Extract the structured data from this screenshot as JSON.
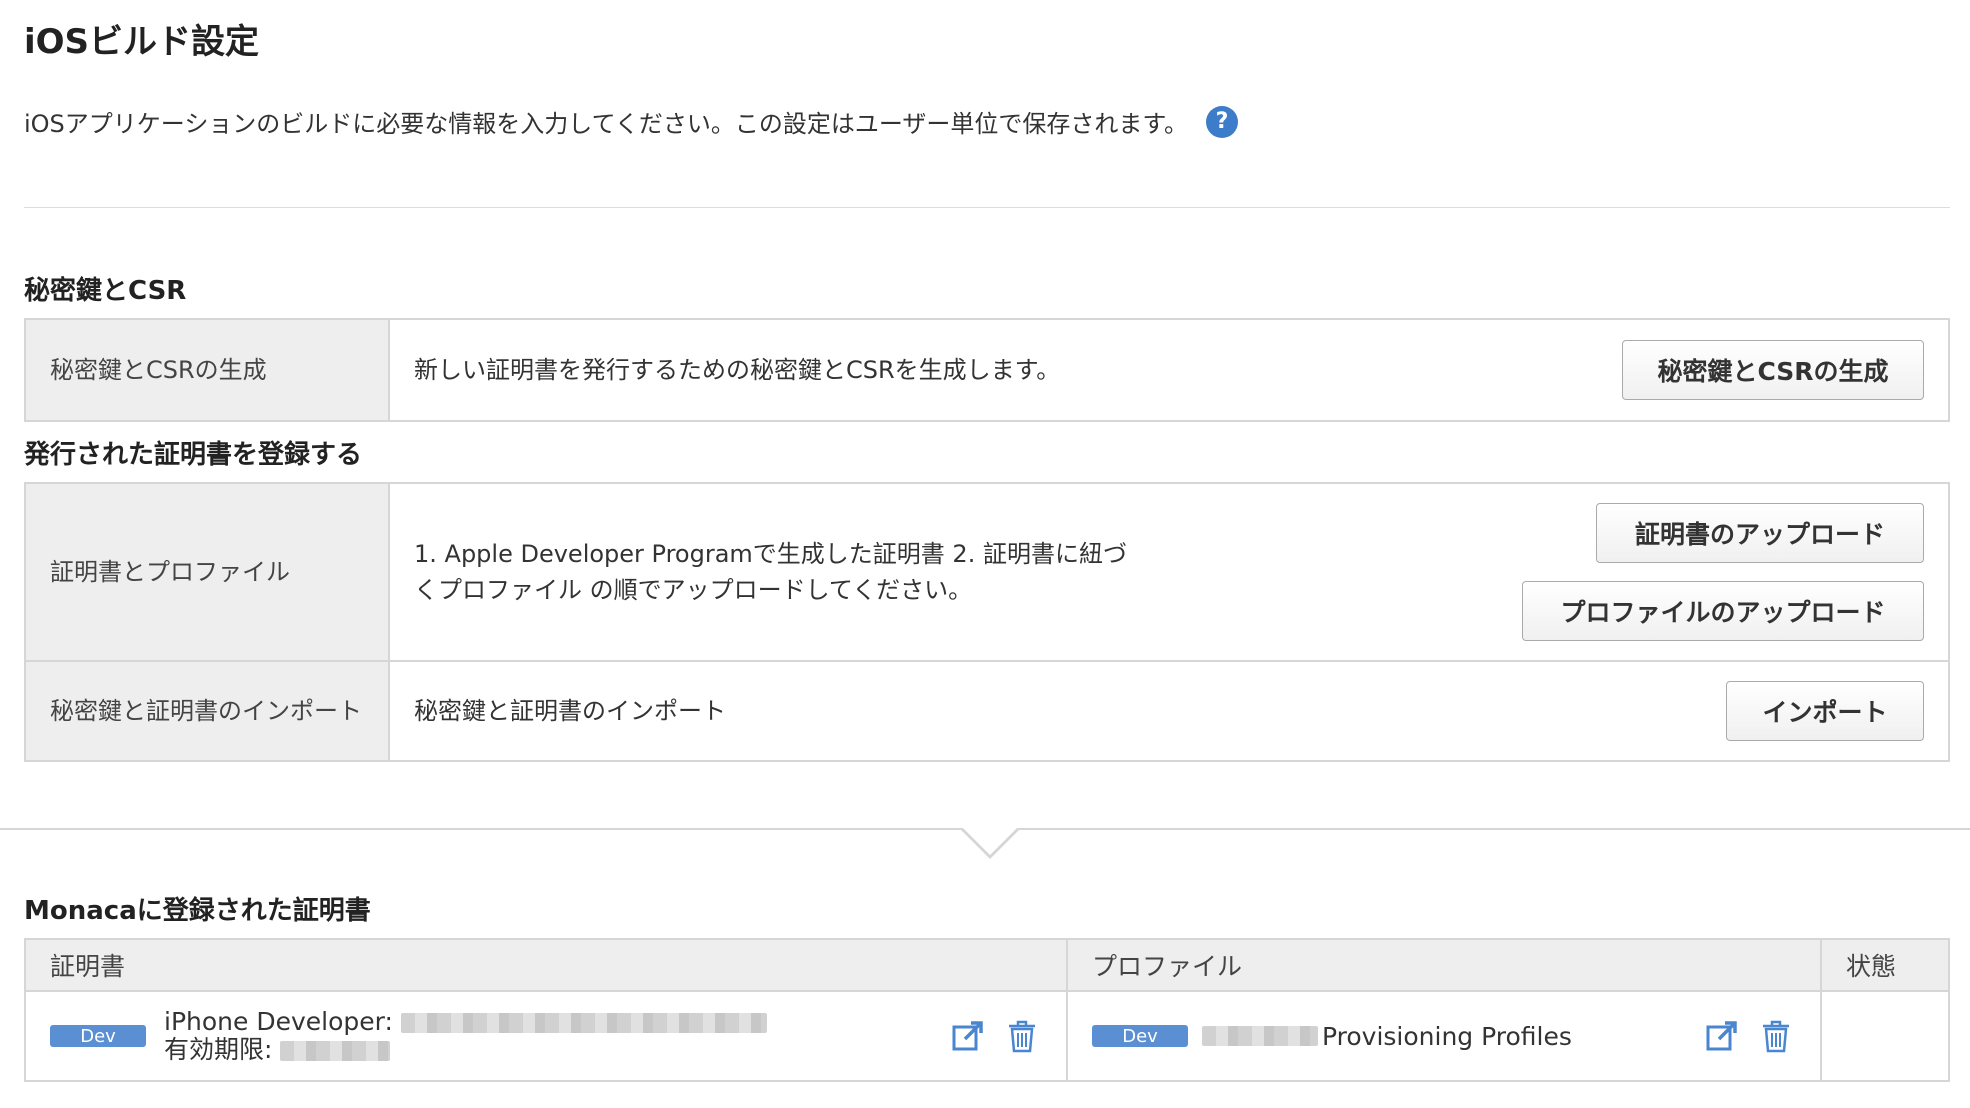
{
  "page": {
    "title": "iOSビルド設定",
    "intro": "iOSアプリケーションのビルドに必要な情報を入力してください。この設定はユーザー単位で保存されます。",
    "help_glyph": "?"
  },
  "csr_section": {
    "title": "秘密鍵とCSR",
    "rows": [
      {
        "label": "秘密鍵とCSRの生成",
        "description": "新しい証明書を発行するための秘密鍵とCSRを生成します。",
        "button": "秘密鍵とCSRの生成"
      }
    ]
  },
  "register_section": {
    "title": "発行された証明書を登録する",
    "rows": [
      {
        "label": "証明書とプロファイル",
        "description_line1": "1. Apple Developer Programで生成した証明書  2. 証明書に紐づ",
        "description_line2": "くプロファイル の順でアップロードしてください。",
        "button_cert": "証明書のアップロード",
        "button_profile": "プロファイルのアップロード"
      },
      {
        "label": "秘密鍵と証明書のインポート",
        "description": "秘密鍵と証明書のインポート",
        "button": "インポート"
      }
    ]
  },
  "registered": {
    "title": "Monacaに登録された証明書",
    "headers": {
      "certificate": "証明書",
      "profile": "プロファイル",
      "status": "状態"
    },
    "certificate": {
      "badge": "Dev",
      "name_prefix": "iPhone Developer:",
      "expiry_label": "有効期限:"
    },
    "profile": {
      "badge": "Dev",
      "name_suffix": "Provisioning Profiles"
    },
    "status": ""
  },
  "colors": {
    "accent": "#3d7cc9",
    "badge": "#5b8fd4",
    "border": "#d6d6d6",
    "label_bg": "#eeeeee"
  },
  "icons": [
    "help-icon",
    "open-external-icon",
    "trash-icon"
  ]
}
